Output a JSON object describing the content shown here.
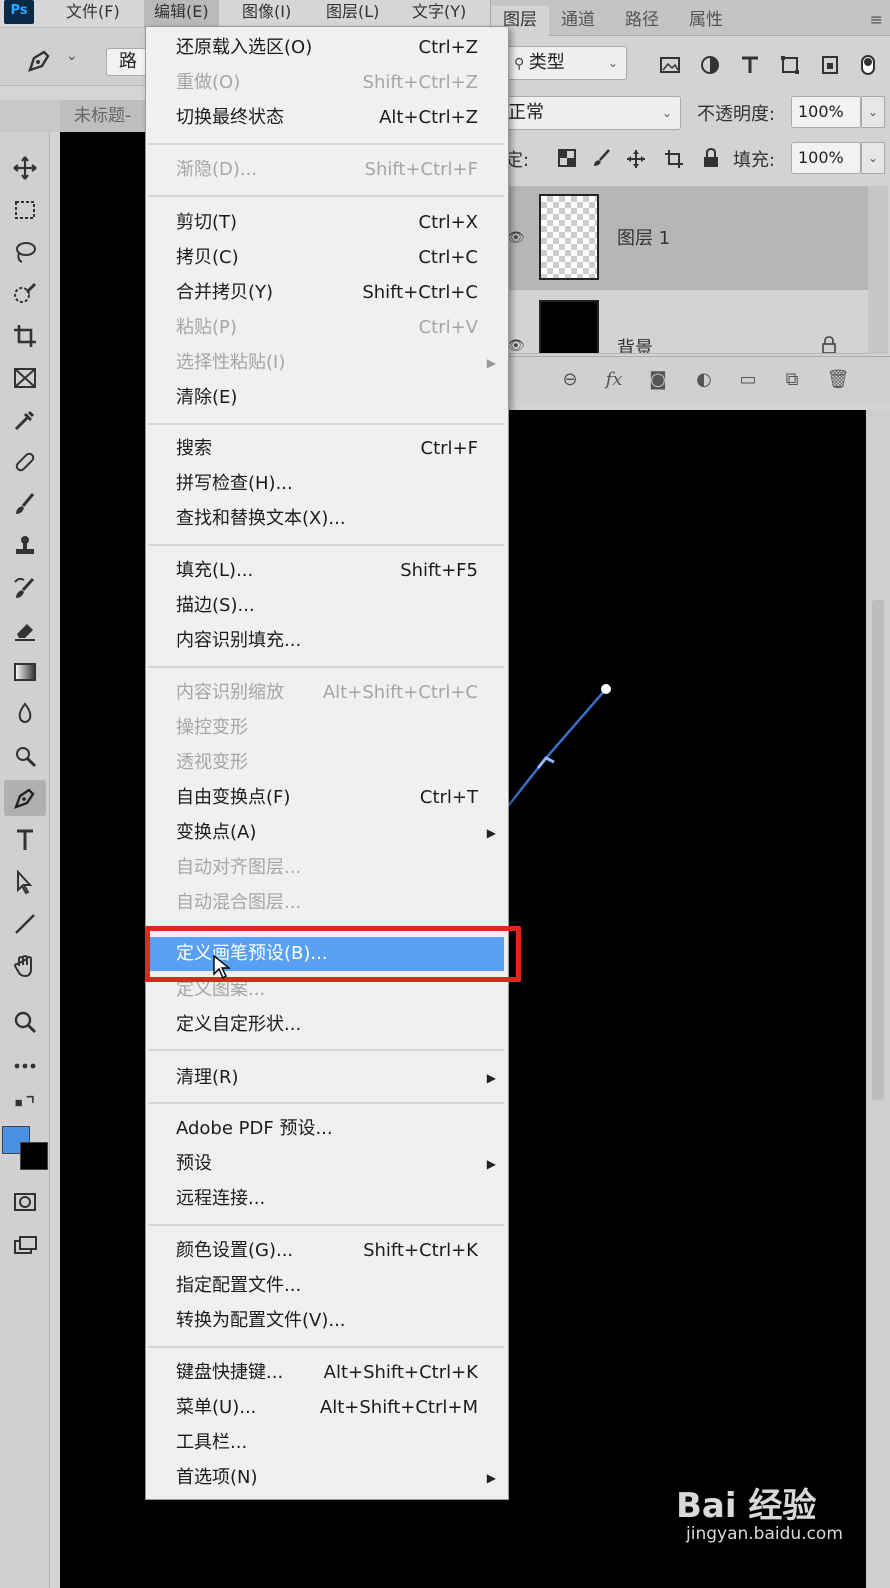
{
  "app": {
    "logo": "Ps"
  },
  "menubar": {
    "items": [
      "文件(F)",
      "编辑(E)",
      "图像(I)",
      "图层(L)",
      "文字(Y)"
    ],
    "active": "编辑(E)"
  },
  "options_bar": {
    "path_mode": "路"
  },
  "doc_tab": {
    "title": "未标题-"
  },
  "layers_panel": {
    "tabs": [
      "图层",
      "通道",
      "路径",
      "属性"
    ],
    "filter_kind": "类型",
    "blend_mode": "正常",
    "opacity_label": "不透明度:",
    "opacity_value": "100%",
    "lock_label": "锁定:",
    "lock_label_visible": "定:",
    "fill_label": "填充:",
    "fill_value": "100%",
    "layers": [
      {
        "name": "图层 1",
        "selected": true
      },
      {
        "name": "背景",
        "locked": true
      }
    ],
    "actions_fx": "fx"
  },
  "edit_menu": {
    "items": [
      {
        "label": "还原载入选区(O)",
        "shortcut": "Ctrl+Z"
      },
      {
        "label": "重做(O)",
        "shortcut": "Shift+Ctrl+Z",
        "disabled": true
      },
      {
        "label": "切换最终状态",
        "shortcut": "Alt+Ctrl+Z"
      },
      {
        "label": "渐隐(D)...",
        "shortcut": "Shift+Ctrl+F",
        "disabled": true
      },
      {
        "label": "剪切(T)",
        "shortcut": "Ctrl+X"
      },
      {
        "label": "拷贝(C)",
        "shortcut": "Ctrl+C"
      },
      {
        "label": "合并拷贝(Y)",
        "shortcut": "Shift+Ctrl+C"
      },
      {
        "label": "粘贴(P)",
        "shortcut": "Ctrl+V",
        "disabled": true
      },
      {
        "label": "选择性粘贴(I)",
        "shortcut": "",
        "disabled": true,
        "submenu": true
      },
      {
        "label": "清除(E)",
        "shortcut": ""
      },
      {
        "label": "搜索",
        "shortcut": "Ctrl+F"
      },
      {
        "label": "拼写检查(H)...",
        "shortcut": ""
      },
      {
        "label": "查找和替换文本(X)...",
        "shortcut": ""
      },
      {
        "label": "填充(L)...",
        "shortcut": "Shift+F5"
      },
      {
        "label": "描边(S)...",
        "shortcut": ""
      },
      {
        "label": "内容识别填充...",
        "shortcut": ""
      },
      {
        "label": "内容识别缩放",
        "shortcut": "Alt+Shift+Ctrl+C",
        "disabled": true
      },
      {
        "label": "操控变形",
        "shortcut": "",
        "disabled": true
      },
      {
        "label": "透视变形",
        "shortcut": "",
        "disabled": true
      },
      {
        "label": "自由变换点(F)",
        "shortcut": "Ctrl+T"
      },
      {
        "label": "变换点(A)",
        "shortcut": "",
        "submenu": true
      },
      {
        "label": "自动对齐图层...",
        "shortcut": "",
        "disabled": true
      },
      {
        "label": "自动混合图层...",
        "shortcut": "",
        "disabled": true
      },
      {
        "label": "定义画笔预设(B)...",
        "shortcut": "",
        "highlighted": true
      },
      {
        "label": "定义图案...",
        "shortcut": "",
        "disabled": true
      },
      {
        "label": "定义自定形状...",
        "shortcut": ""
      },
      {
        "label": "清理(R)",
        "shortcut": "",
        "submenu": true
      },
      {
        "label": "Adobe PDF 预设...",
        "shortcut": ""
      },
      {
        "label": "预设",
        "shortcut": "",
        "submenu": true
      },
      {
        "label": "远程连接...",
        "shortcut": ""
      },
      {
        "label": "颜色设置(G)...",
        "shortcut": "Shift+Ctrl+K"
      },
      {
        "label": "指定配置文件...",
        "shortcut": ""
      },
      {
        "label": "转换为配置文件(V)...",
        "shortcut": ""
      },
      {
        "label": "键盘快捷键...",
        "shortcut": "Alt+Shift+Ctrl+K"
      },
      {
        "label": "菜单(U)...",
        "shortcut": "Alt+Shift+Ctrl+M"
      },
      {
        "label": "工具栏...",
        "shortcut": ""
      },
      {
        "label": "首选项(N)",
        "shortcut": "",
        "submenu": true
      }
    ]
  },
  "colors": {
    "foreground": "#4a90e2",
    "background": "#000000",
    "highlight": "#5aa0f2",
    "callout_border": "#e0271f"
  },
  "watermark": {
    "logo": "Bai 经验",
    "url": "jingyan.baidu.com"
  }
}
